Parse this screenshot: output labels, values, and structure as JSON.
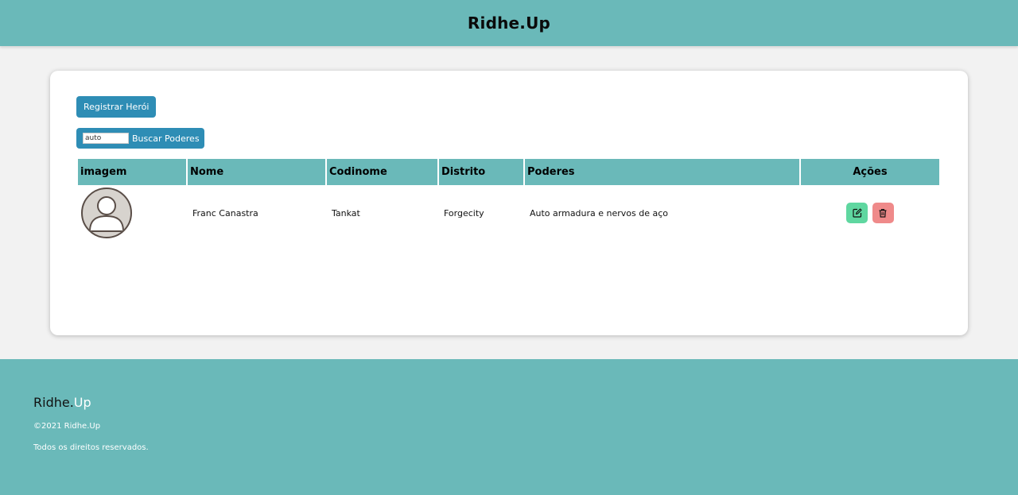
{
  "header": {
    "title": "Ridhe.Up"
  },
  "toolbar": {
    "register_label": "Registrar Herói",
    "search_value": "auto",
    "search_label": "Buscar Poderes"
  },
  "table": {
    "headers": [
      "imagem",
      "Nome",
      "Codinome",
      "Distrito",
      "Poderes",
      "Ações"
    ],
    "rows": [
      {
        "name": "Franc Canastra",
        "codename": "Tankat",
        "district": "Forgecity",
        "powers": "Auto armadura e nervos de aço"
      }
    ]
  },
  "icons": {
    "avatar": "user-avatar-icon",
    "edit": "edit-icon",
    "delete": "trash-icon"
  },
  "colors": {
    "primary": "#6ab9b9",
    "button": "#2e8db5",
    "edit": "#5fd7a0",
    "delete": "#ef8a8a"
  },
  "footer": {
    "brand_a": "Ridhe.",
    "brand_b": "Up",
    "copyright": "©2021 Ridhe.Up",
    "rights": "Todos os direitos reservados."
  }
}
